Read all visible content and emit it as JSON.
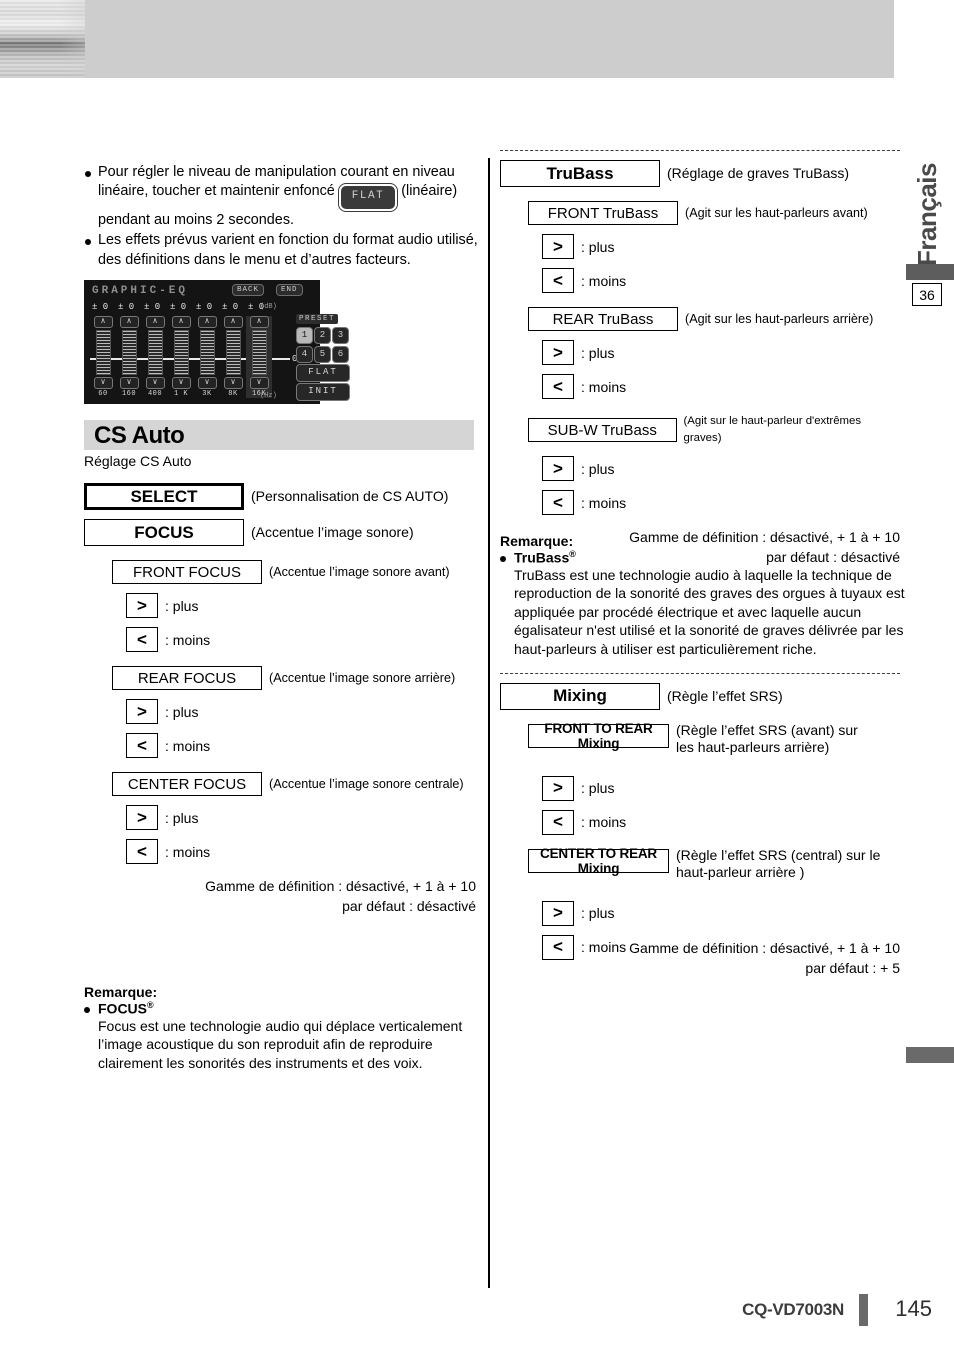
{
  "header": {
    "band_color": "#cdcdcd"
  },
  "intro": {
    "bullets": [
      {
        "part1": "Pour régler le niveau de manipulation courant en niveau linéaire, toucher et maintenir enfoncé",
        "pill": "FLAT",
        "part2": "(linéaire) pendant au moins 2 secondes."
      },
      {
        "part1": "Les effets prévus varient en fonction du format audio utilisé, des définitions dans le menu et d’autres facteurs.",
        "pill": "",
        "part2": ""
      }
    ]
  },
  "eq_screen": {
    "title": "GRAPHIC-EQ",
    "back_label": "BACK",
    "end_label": "END",
    "db_values": [
      "± 0",
      "± 0",
      "± 0",
      "± 0",
      "± 0",
      "± 0",
      "± 0"
    ],
    "db_unit": "(dB)",
    "frequencies": [
      "60",
      "160",
      "400",
      "1 K",
      "3K",
      "8K",
      "16K"
    ],
    "hz_unit": "(Hz)",
    "zero_label": "0",
    "up_glyph": "∧",
    "down_glyph": "∨",
    "preset_label": "PRESET",
    "preset_numbers": [
      "1",
      "2",
      "3",
      "4",
      "5",
      "6"
    ],
    "preset_selected": "1",
    "flat_label": "FLAT",
    "init_label": "INIT",
    "selected_band_index": 6
  },
  "cs_auto": {
    "heading": "CS Auto",
    "subheading": "Réglage CS Auto",
    "select": {
      "label": "SELECT",
      "desc": "(Personnalisation de CS AUTO)"
    },
    "focus": {
      "label": "FOCUS",
      "desc": "(Accentue l’image sonore)"
    },
    "items": [
      {
        "label": "FRONT FOCUS",
        "desc": "(Accentue l’image sonore avant)"
      },
      {
        "label": "REAR FOCUS",
        "desc": "(Accentue l’image sonore arrière)"
      },
      {
        "label": "CENTER FOCUS",
        "desc": "(Accentue l’image sonore centrale)"
      }
    ],
    "plus_glyph": ">",
    "minus_glyph": "<",
    "plus_label": ": plus",
    "minus_label": ": moins",
    "range_line1": "Gamme de définition : désactivé, + 1 à + 10",
    "range_line2": "par défaut : désactivé"
  },
  "note_focus": {
    "title": "Remarque:",
    "term": "FOCUS",
    "reg": "®",
    "body": "Focus est une technologie audio qui déplace verticalement l’image acoustique du son reproduit afin de reproduire clairement les sonorités des instruments et des voix."
  },
  "trubass": {
    "header": {
      "label": "TruBass",
      "desc": "(Réglage de graves TruBass)"
    },
    "items": [
      {
        "label": "FRONT TruBass",
        "desc": "(Agit sur les haut-parleurs avant)"
      },
      {
        "label": "REAR TruBass",
        "desc": "(Agit sur les haut-parleurs arrière)"
      },
      {
        "label": "SUB-W TruBass",
        "desc": "(Agit sur le haut-parleur d'extrêmes graves)"
      }
    ],
    "plus_glyph": ">",
    "minus_glyph": "<",
    "plus_label": ": plus",
    "minus_label": ": moins",
    "range_line1": "Gamme de définition : désactivé, + 1 à + 10",
    "range_line2": "par défaut : désactivé"
  },
  "note_trubass": {
    "title": "Remarque:",
    "term": "TruBass",
    "reg": "®",
    "body": "TruBass est une technologie audio à laquelle la technique de reproduction de la sonorité des graves des orgues à tuyaux est appliquée par procédé électrique et avec laquelle aucun égalisateur n'est utilisé et la sonorité de graves délivrée par les haut-parleurs à utiliser est particulièrement riche."
  },
  "mixing": {
    "header": {
      "label": "Mixing",
      "desc": "(Règle l’effet SRS)"
    },
    "items": [
      {
        "label": "FRONT TO REAR Mixing",
        "desc_line1": "(Règle l’effet SRS (avant) sur",
        "desc_line2": "les haut-parleurs arrière)"
      },
      {
        "label": "CENTER TO REAR Mixing",
        "desc_line1": "(Règle l’effet SRS (central) sur le",
        "desc_line2": "haut-parleur arrière )"
      }
    ],
    "plus_glyph": ">",
    "minus_glyph": "<",
    "plus_label": ": plus",
    "minus_label": ": moins",
    "range_line1": "Gamme de définition : désactivé, + 1 à + 10",
    "range_line2": "par défaut : + 5"
  },
  "margin": {
    "language": "Français",
    "section_number": "36"
  },
  "footer": {
    "model": "CQ-VD7003N",
    "page": "145"
  }
}
